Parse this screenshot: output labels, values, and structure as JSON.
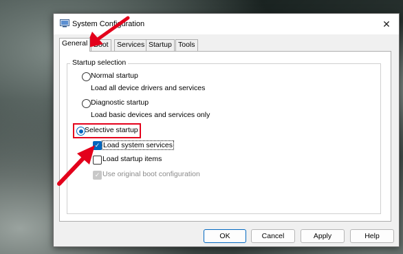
{
  "window": {
    "title": "System Configuration",
    "close_glyph": "✕"
  },
  "tabs": [
    {
      "label": "General",
      "active": true
    },
    {
      "label": "Boot"
    },
    {
      "label": "Services"
    },
    {
      "label": "Startup"
    },
    {
      "label": "Tools"
    }
  ],
  "startup_selection": {
    "group_label": "Startup selection",
    "normal": {
      "label": "Normal startup",
      "description": "Load all device drivers and services",
      "selected": false
    },
    "diagnostic": {
      "label": "Diagnostic startup",
      "description": "Load basic devices and services only",
      "selected": false
    },
    "selective": {
      "label": "Selective startup",
      "selected": true
    },
    "load_system_services": {
      "label": "Load system services",
      "checked": true
    },
    "load_startup_items": {
      "label": "Load startup items",
      "checked": false
    },
    "use_original_boot": {
      "label": "Use original boot configuration",
      "checked": true,
      "disabled": true
    }
  },
  "buttons": {
    "ok": "OK",
    "cancel": "Cancel",
    "apply": "Apply",
    "help": "Help"
  },
  "annotation_colors": {
    "highlight": "#e3001b",
    "accent": "#0067c0"
  }
}
